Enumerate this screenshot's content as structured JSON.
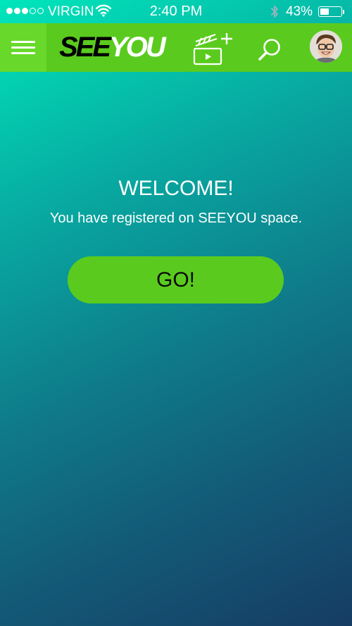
{
  "status_bar": {
    "signal_bars_filled": 3,
    "signal_bars_total": 5,
    "carrier": "VIRGIN",
    "wifi_icon": "wifi-icon",
    "time": "2:40 PM",
    "bluetooth_icon": "bluetooth-icon",
    "battery_percent_label": "43%",
    "battery_level": 0.43
  },
  "nav_bar": {
    "background_color": "#5acb1e",
    "menu_icon": "hamburger-menu-icon",
    "logo": {
      "part1": "SEE",
      "part2": "YOU"
    },
    "new_video_icon": "clapperboard-plus-icon",
    "search_icon": "search-icon",
    "avatar": "user-avatar"
  },
  "main": {
    "title": "WELCOME!",
    "subtitle": "You have registered on SEEYOU space.",
    "go_button_label": "GO!",
    "accent_color": "#5acb1e"
  }
}
